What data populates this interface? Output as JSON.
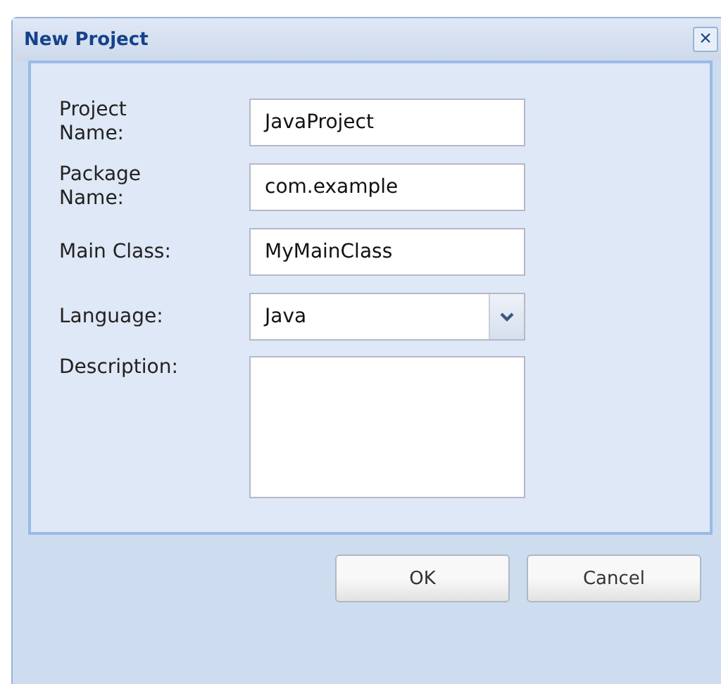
{
  "window": {
    "title": "New Project",
    "close": "×"
  },
  "fields": [
    {
      "kind": "text",
      "label": "Project Name:",
      "value": "JavaProject"
    },
    {
      "kind": "text",
      "label": "Package Name:",
      "value": "com.example"
    },
    {
      "kind": "text",
      "label": "Main Class:",
      "value": "MyMainClass"
    },
    {
      "kind": "select",
      "label": "Language:",
      "value": "Java"
    },
    {
      "kind": "textarea",
      "label": "Description:"
    }
  ],
  "buttons": [
    "OK",
    "Cancel"
  ]
}
